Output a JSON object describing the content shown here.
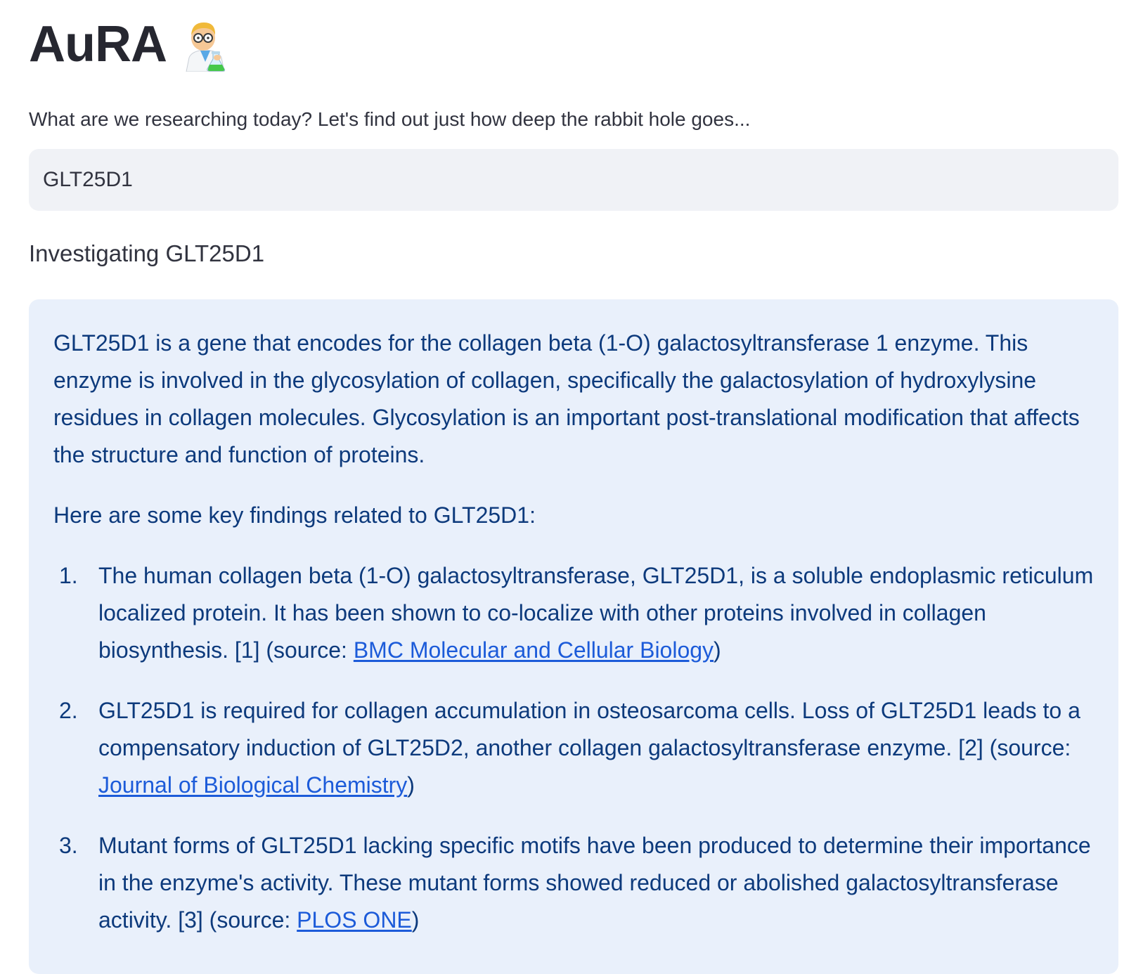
{
  "app": {
    "title": "AuRA",
    "title_icon": "scientist-icon"
  },
  "search": {
    "label": "What are we researching today? Let's find out just how deep the rabbit hole goes...",
    "value": "GLT25D1"
  },
  "status": {
    "text": "Investigating GLT25D1"
  },
  "result": {
    "intro": "GLT25D1 is a gene that encodes for the collagen beta (1-O) galactosyltransferase 1 enzyme. This enzyme is involved in the glycosylation of collagen, specifically the galactosylation of hydroxylysine residues in collagen molecules. Glycosylation is an important post-translational modification that affects the structure and function of proteins.",
    "findings_heading": "Here are some key findings related to GLT25D1:",
    "findings": [
      {
        "number": "1.",
        "text": "The human collagen beta (1-O) galactosyltransferase, GLT25D1, is a soluble endoplasmic reticulum localized protein. It has been shown to co-localize with other proteins involved in collagen biosynthesis. [1] (source: ",
        "source": "BMC Molecular and Cellular Biology",
        "close": ")"
      },
      {
        "number": "2.",
        "text": "GLT25D1 is required for collagen accumulation in osteosarcoma cells. Loss of GLT25D1 leads to a compensatory induction of GLT25D2, another collagen galactosyltransferase enzyme. [2] (source: ",
        "source": "Journal of Biological Chemistry",
        "close": ")"
      },
      {
        "number": "3.",
        "text": "Mutant forms of GLT25D1 lacking specific motifs have been produced to determine their importance in the enzyme's activity. These mutant forms showed reduced or abolished galactosyltransferase activity. [3] (source: ",
        "source": "PLOS ONE",
        "close": ")"
      }
    ]
  },
  "colors": {
    "info_background": "#e9f0fb",
    "info_text": "#0d3a7c",
    "link": "#1c5bd9",
    "input_background": "#f0f2f6"
  }
}
